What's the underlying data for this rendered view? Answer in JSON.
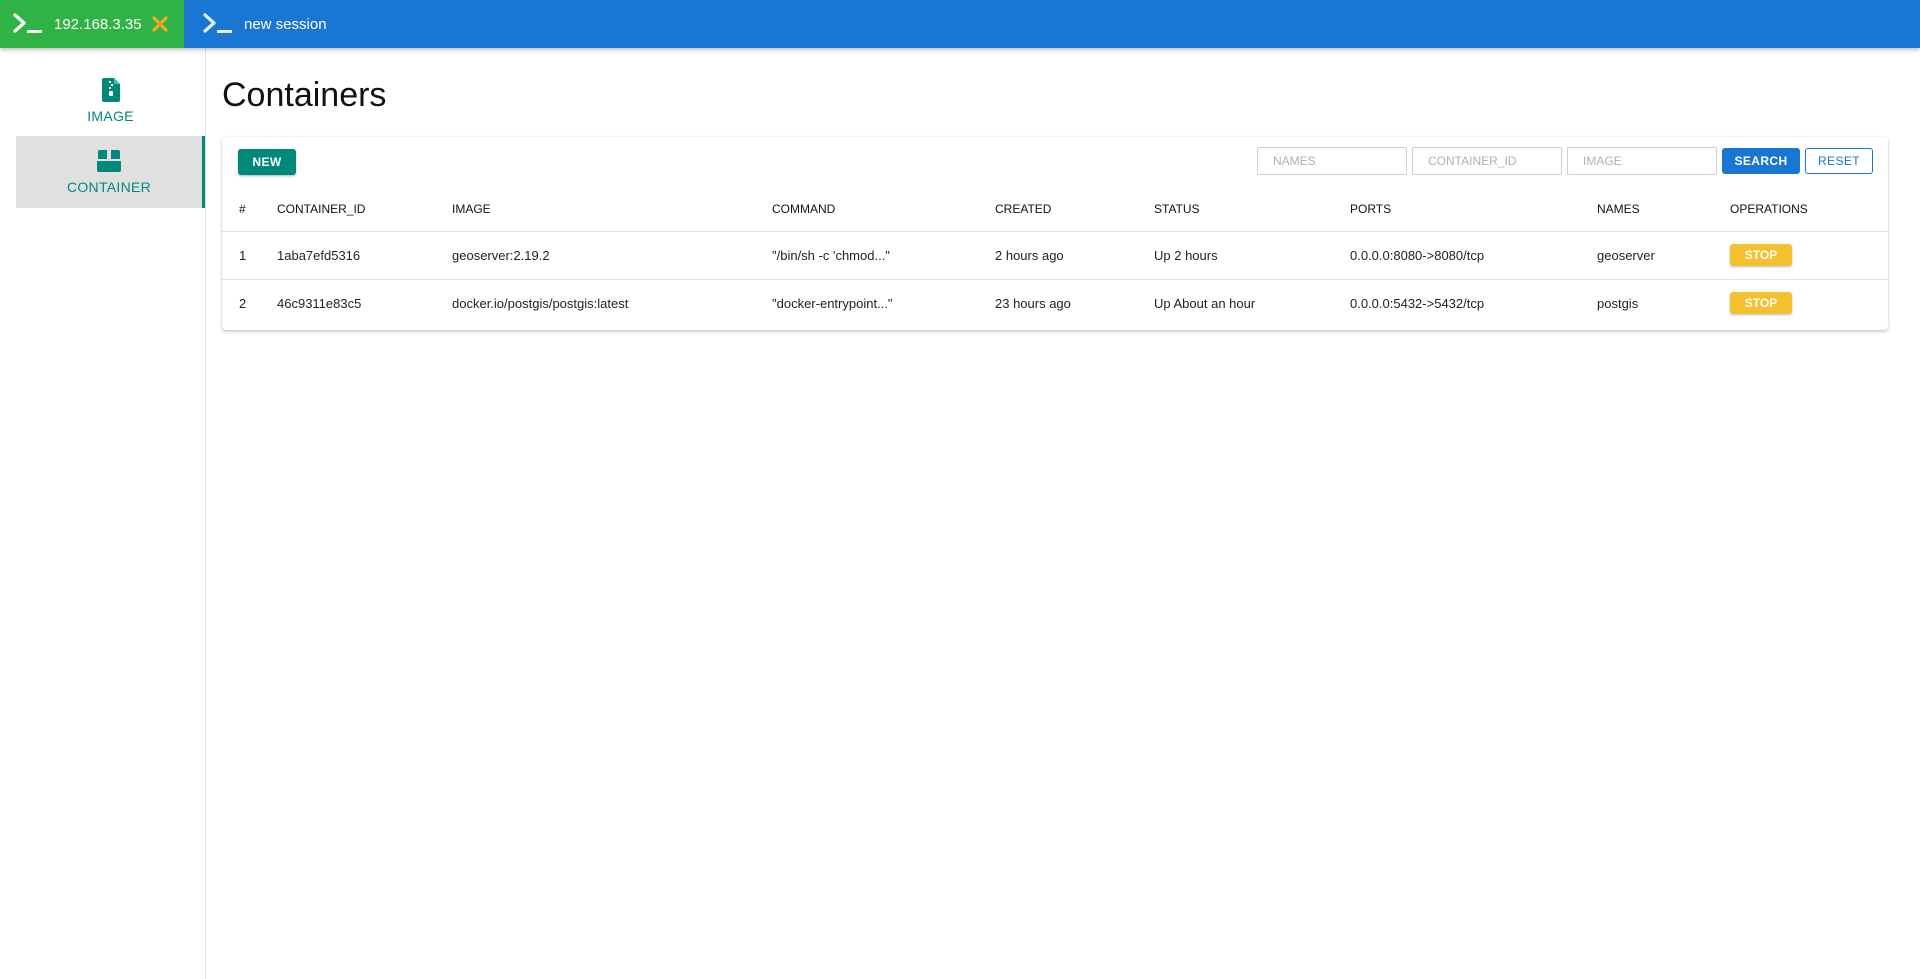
{
  "topbar": {
    "tabs": [
      {
        "label": "192.168.3.35",
        "active": true,
        "icon": "terminal-prompt-icon"
      },
      {
        "label": "new session",
        "active": false,
        "icon": "terminal-prompt-icon"
      }
    ],
    "colors": {
      "bar": "#1976d2",
      "active_tab": "#2fb344",
      "close": "#f5a623"
    }
  },
  "sidebar": {
    "items": [
      {
        "label": "IMAGE",
        "icon": "archive-file-icon"
      },
      {
        "label": "CONTAINER",
        "icon": "box-icon",
        "selected": true
      }
    ]
  },
  "page": {
    "title": "Containers"
  },
  "toolbar": {
    "new_label": "NEW",
    "filters": [
      {
        "placeholder": "NAMES"
      },
      {
        "placeholder": "CONTAINER_ID"
      },
      {
        "placeholder": "IMAGE"
      }
    ],
    "search_label": "SEARCH",
    "reset_label": "RESET"
  },
  "table": {
    "headers": [
      "#",
      "CONTAINER_ID",
      "IMAGE",
      "COMMAND",
      "CREATED",
      "STATUS",
      "PORTS",
      "NAMES",
      "OPERATIONS"
    ],
    "rows": [
      {
        "num": "1",
        "container_id": "1aba7efd5316",
        "image": "geoserver:2.19.2",
        "command": "\"/bin/sh -c 'chmod...\"",
        "created": "2 hours ago",
        "status": "Up 2 hours",
        "ports": "0.0.0.0:8080->8080/tcp",
        "names": "geoserver",
        "op": "STOP"
      },
      {
        "num": "2",
        "container_id": "46c9311e83c5",
        "image": "docker.io/postgis/postgis:latest",
        "command": "\"docker-entrypoint...\"",
        "created": "23 hours ago",
        "status": "Up About an hour",
        "ports": "0.0.0.0:5432->5432/tcp",
        "names": "postgis",
        "op": "STOP"
      }
    ]
  }
}
